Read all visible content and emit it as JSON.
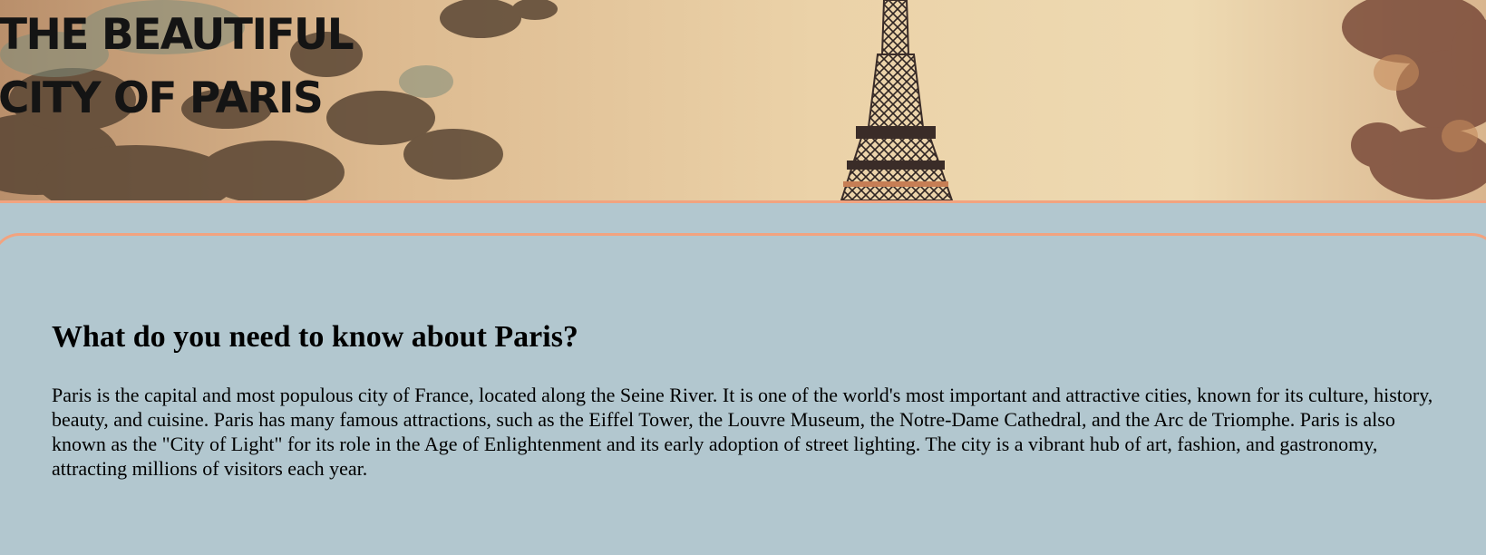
{
  "hero": {
    "title_line1": "THE BEAUTIFUL",
    "title_line2": "CITY OF PARIS",
    "image": "eiffel-tower-photo"
  },
  "section": {
    "heading": "What do you need to know about Paris?",
    "body": "Paris is the capital and most populous city of France, located along the Seine River. It is one of the world's most important and attractive cities, known for its culture, history, beauty, and cuisine. Paris has many famous attractions, such as the Eiffel Tower, the Louvre Museum, the Notre-Dame Cathedral, and the Arc de Triomphe. Paris is also known as the \"City of Light\" for its role in the Age of Enlightenment and its early adoption of street lighting. The city is a vibrant hub of art, fashion, and gastronomy, attracting millions of visitors each year."
  },
  "colors": {
    "background": "#b2c7cf",
    "accent_border": "#f2a37f",
    "sky": "#ecd4aa",
    "tower": "#4a3a35"
  }
}
